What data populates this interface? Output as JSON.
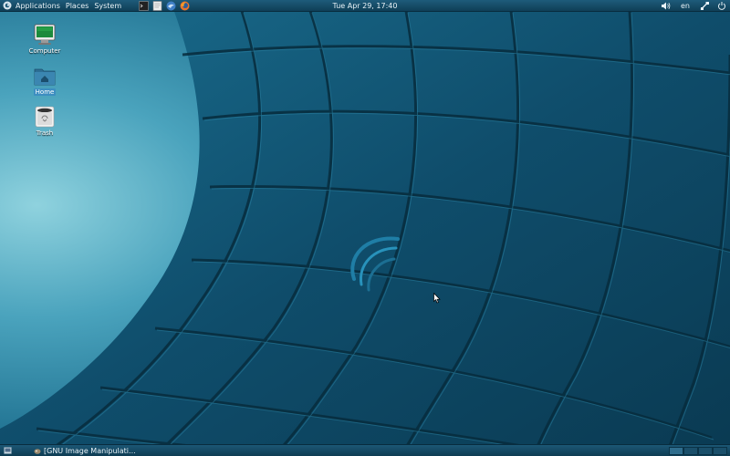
{
  "top_panel": {
    "menus": [
      "Applications",
      "Places",
      "System"
    ],
    "launchers": [
      "terminal-icon",
      "text-editor-icon",
      "thunderbird-icon",
      "firefox-icon"
    ],
    "clock": "Tue Apr 29, 17:40",
    "tray": {
      "volume_icon": "speaker-icon",
      "keyboard_layout": "en",
      "network_icon": "network-icon",
      "power_icon": "power-icon"
    }
  },
  "desktop": {
    "icons": [
      {
        "label": "Computer",
        "icon": "computer-icon"
      },
      {
        "label": "Home",
        "icon": "home-folder-icon"
      },
      {
        "label": "Trash",
        "icon": "trash-icon"
      }
    ]
  },
  "bottom_panel": {
    "show_desktop_icon": "show-desktop-icon",
    "task_label": "[GNU Image Manipulati...",
    "workspaces": 4,
    "active_workspace": 1
  },
  "colors": {
    "panel": "#174f6a",
    "wallpaper_dark": "#0c3d57",
    "wallpaper_light": "#4aa3bd",
    "selection": "#3d8ec0"
  }
}
